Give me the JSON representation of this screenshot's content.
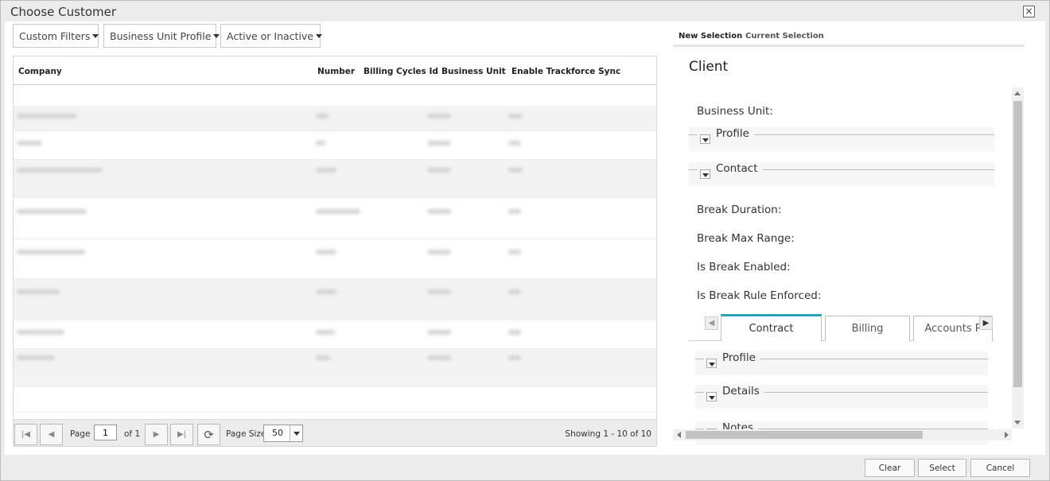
{
  "window": {
    "title": "Choose Customer",
    "close_label": "×"
  },
  "filters": [
    {
      "label": "Custom Filters"
    },
    {
      "label": "Business Unit Profile"
    },
    {
      "label": "Active or Inactive"
    }
  ],
  "grid": {
    "columns": [
      "Company",
      "Number",
      "Billing Cycles Id",
      "Business Unit",
      "Enable Trackforce Sync"
    ]
  },
  "pager": {
    "first_icon": "|◀",
    "prev_icon": "◀",
    "next_icon": "▶",
    "last_icon": "▶|",
    "refresh_icon": "⟳",
    "page_label": "Page",
    "page_value": "1",
    "of_label": "of 1",
    "page_size_label": "Page Size",
    "page_size_value": "50",
    "showing": "Showing 1 - 10 of 10"
  },
  "right_panel": {
    "tabs": [
      "New Selection",
      "Current Selection"
    ],
    "title": "Client",
    "fields": {
      "business_unit": "Business Unit:",
      "break_duration": "Break Duration:",
      "break_max_range": "Break Max Range:",
      "is_break_enabled": "Is Break Enabled:",
      "is_break_rule_enforced": "Is Break Rule Enforced:"
    },
    "groups": {
      "profile": "Profile",
      "contact": "Contact"
    },
    "subtabs": [
      "Contract",
      "Billing",
      "Accounts P"
    ],
    "subgroups": {
      "profile": "Profile",
      "details": "Details",
      "notes": "Notes"
    }
  },
  "buttons": {
    "clear": "Clear",
    "select": "Select",
    "cancel": "Cancel"
  }
}
